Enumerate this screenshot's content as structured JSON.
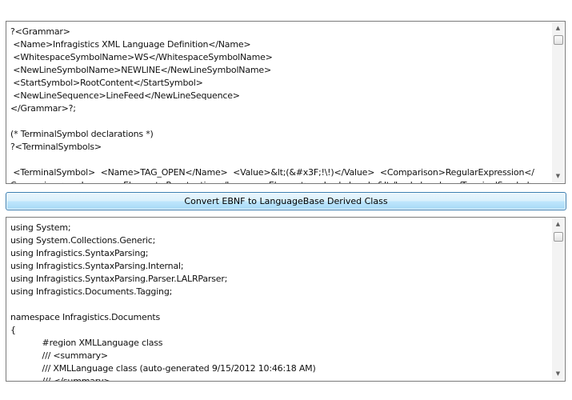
{
  "grammar_editor": {
    "lines": [
      "?<Grammar>",
      " <Name>Infragistics XML Language Definition</Name>",
      " <WhitespaceSymbolName>WS</WhitespaceSymbolName>",
      " <NewLineSymbolName>NEWLINE</NewLineSymbolName>",
      " <StartSymbol>RootContent</StartSymbol>",
      " <NewLineSequence>LineFeed</NewLineSequence>",
      "</Grammar>?;",
      "",
      "(* TerminalSymbol declarations *)",
      "?<TerminalSymbols>",
      "",
      " <TerminalSymbol>  <Name>TAG_OPEN</Name>  <Value>&lt;(&#x3F;!\\!)</Value>  <Comparison>RegularExpression</",
      "Comparison>  <LanguageElement>Punctuation</LanguageElement>  <Lookahead>&lt;/Lookahead> </TerminalSymbol>"
    ]
  },
  "convert_button": {
    "label": "Convert EBNF to LanguageBase Derived Class"
  },
  "output_editor": {
    "lines": [
      "using System;",
      "using System.Collections.Generic;",
      "using Infragistics.SyntaxParsing;",
      "using Infragistics.SyntaxParsing.Internal;",
      "using Infragistics.SyntaxParsing.Parser.LALRParser;",
      "using Infragistics.Documents.Tagging;",
      "",
      "namespace Infragistics.Documents",
      "{",
      "            #region XMLLanguage class",
      "            /// <summary>",
      "            /// XMLLanguage class (auto-generated 9/15/2012 10:46:18 AM)",
      "            /// </summary>"
    ]
  },
  "scrollbar": {
    "up_glyph": "▲",
    "down_glyph": "▼"
  }
}
